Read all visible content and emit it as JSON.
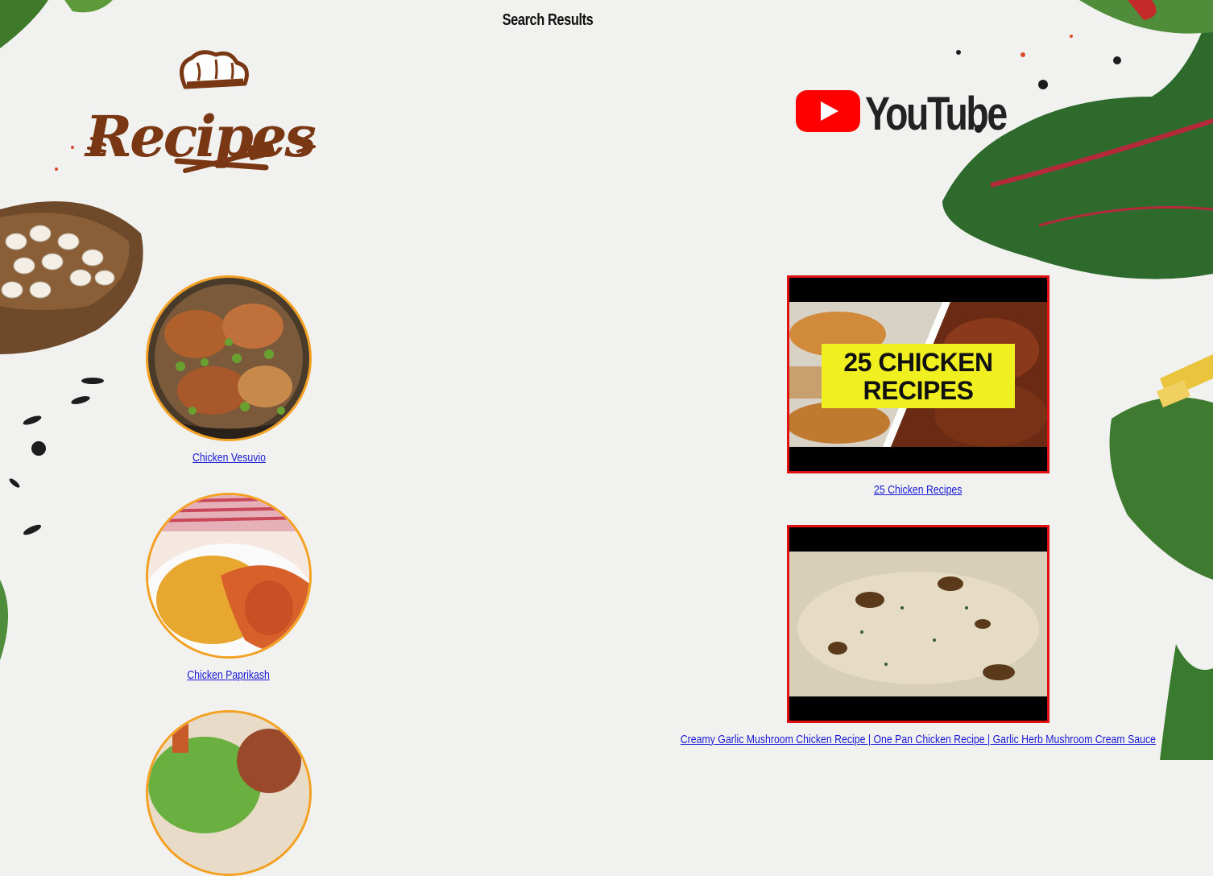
{
  "page": {
    "title": "Search Results"
  },
  "logos": {
    "recipes": "Recipes",
    "youtube": "YouTube"
  },
  "recipes": [
    {
      "title": "Chicken Vesuvio"
    },
    {
      "title": "Chicken Paprikash"
    }
  ],
  "videos": [
    {
      "title": "25 Chicken Recipes",
      "thumb_text": [
        "25 CHICKEN",
        "RECIPES"
      ]
    },
    {
      "title": "Creamy Garlic Mushroom Chicken Recipe | One Pan Chicken Recipe | Garlic Herb Mushroom Cream Sauce"
    }
  ],
  "colors": {
    "recipe_border": "#f4a020",
    "video_border": "#e21111",
    "link": "#1a1ad6",
    "logo_brown": "#7a3713",
    "youtube_red": "#ff0000"
  }
}
